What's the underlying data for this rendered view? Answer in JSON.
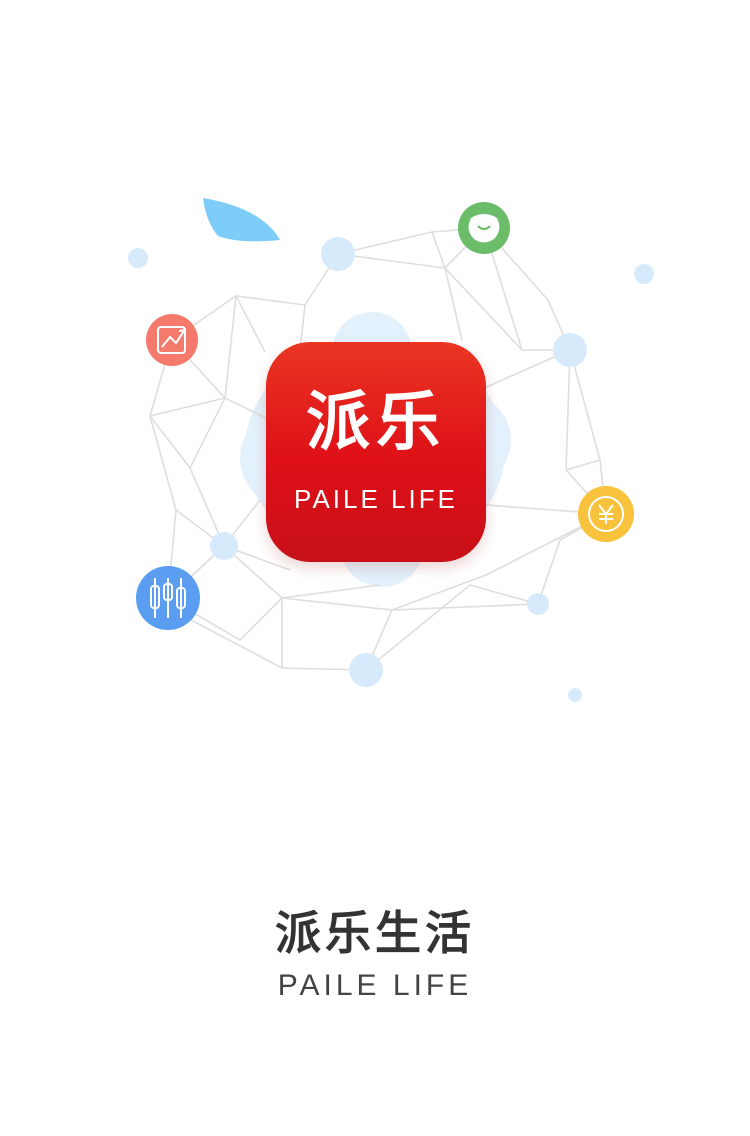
{
  "splash": {
    "app_icon": {
      "name_cn": "派乐",
      "name_en": "PAILE LIFE",
      "color": "#e01b1f"
    },
    "brand": {
      "title_cn": "派乐生活",
      "subtitle_en": "PAILE LIFE"
    },
    "feature_icons": [
      {
        "icon": "trend-chart-icon",
        "color": "#f47a6c"
      },
      {
        "icon": "bean-icon",
        "color": "#6bbd6a"
      },
      {
        "icon": "yen-coin-icon",
        "color": "#f9c23c"
      },
      {
        "icon": "candlestick-icon",
        "color": "#5b9ef1"
      }
    ],
    "accent_colors": {
      "node": "#d6eafb",
      "line": "#dcdcdc",
      "leaf": "#7dcdf8"
    }
  }
}
